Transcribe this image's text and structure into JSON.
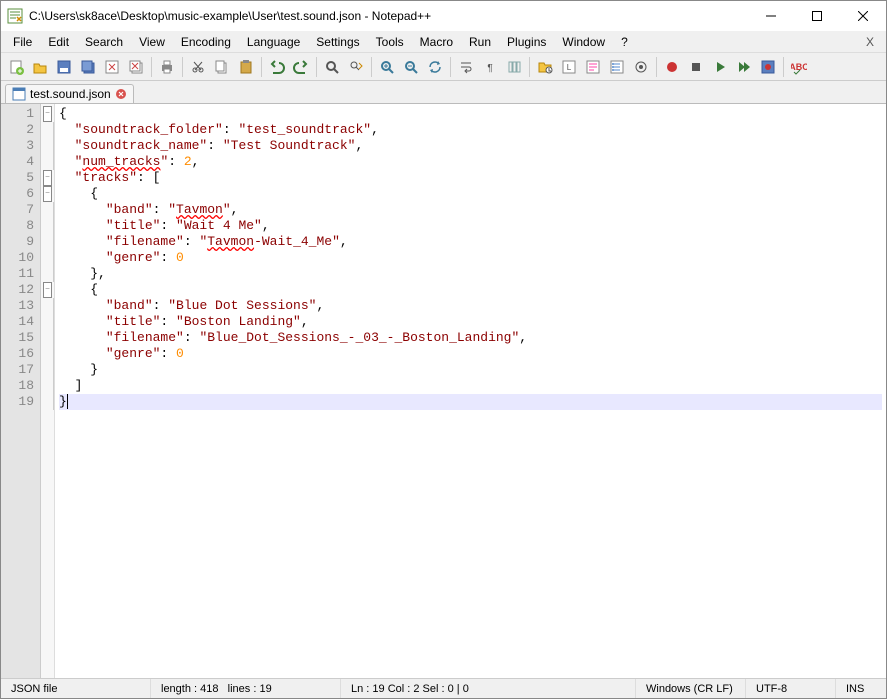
{
  "window": {
    "title": "C:\\Users\\sk8ace\\Desktop\\music-example\\User\\test.sound.json - Notepad++"
  },
  "menu": {
    "items": [
      "File",
      "Edit",
      "Search",
      "View",
      "Encoding",
      "Language",
      "Settings",
      "Tools",
      "Macro",
      "Run",
      "Plugins",
      "Window",
      "?"
    ],
    "closeX": "X"
  },
  "toolbar": {
    "icons": [
      "new",
      "open",
      "save",
      "save-all",
      "close",
      "close-all",
      "print",
      "cut",
      "copy",
      "paste",
      "undo",
      "redo",
      "find",
      "replace",
      "zoom-in",
      "zoom-out",
      "sync",
      "wrap",
      "show-all",
      "indent-guide",
      "folder",
      "ud-lang",
      "doc-map",
      "func-list",
      "monitor",
      "record",
      "stop",
      "play",
      "play-multi",
      "save-macro",
      "spellcheck"
    ]
  },
  "tab": {
    "label": "test.sound.json"
  },
  "code": {
    "lines": [
      {
        "num": 1,
        "fold": "box",
        "tokens": [
          {
            "t": "{",
            "c": "p"
          }
        ]
      },
      {
        "num": 2,
        "fold": "line",
        "tokens": [
          {
            "t": "  ",
            "c": "p"
          },
          {
            "t": "\"soundtrack_folder\"",
            "c": "k"
          },
          {
            "t": ": ",
            "c": "p"
          },
          {
            "t": "\"test_soundtrack\"",
            "c": "k"
          },
          {
            "t": ",",
            "c": "p"
          }
        ]
      },
      {
        "num": 3,
        "fold": "line",
        "tokens": [
          {
            "t": "  ",
            "c": "p"
          },
          {
            "t": "\"soundtrack_name\"",
            "c": "k"
          },
          {
            "t": ": ",
            "c": "p"
          },
          {
            "t": "\"Test Soundtrack\"",
            "c": "k"
          },
          {
            "t": ",",
            "c": "p"
          }
        ]
      },
      {
        "num": 4,
        "fold": "line",
        "tokens": [
          {
            "t": "  ",
            "c": "p"
          },
          {
            "t": "\"",
            "c": "k"
          },
          {
            "t": "num_tracks",
            "c": "k u"
          },
          {
            "t": "\"",
            "c": "k"
          },
          {
            "t": ": ",
            "c": "p"
          },
          {
            "t": "2",
            "c": "n"
          },
          {
            "t": ",",
            "c": "p"
          }
        ]
      },
      {
        "num": 5,
        "fold": "box",
        "tokens": [
          {
            "t": "  ",
            "c": "p"
          },
          {
            "t": "\"tracks\"",
            "c": "k"
          },
          {
            "t": ": [",
            "c": "p"
          }
        ]
      },
      {
        "num": 6,
        "fold": "box",
        "tokens": [
          {
            "t": "    {",
            "c": "p"
          }
        ]
      },
      {
        "num": 7,
        "fold": "line",
        "tokens": [
          {
            "t": "      ",
            "c": "p"
          },
          {
            "t": "\"band\"",
            "c": "k"
          },
          {
            "t": ": ",
            "c": "p"
          },
          {
            "t": "\"",
            "c": "k"
          },
          {
            "t": "Tavmon",
            "c": "k u"
          },
          {
            "t": "\"",
            "c": "k"
          },
          {
            "t": ",",
            "c": "p"
          }
        ]
      },
      {
        "num": 8,
        "fold": "line",
        "tokens": [
          {
            "t": "      ",
            "c": "p"
          },
          {
            "t": "\"title\"",
            "c": "k"
          },
          {
            "t": ": ",
            "c": "p"
          },
          {
            "t": "\"Wait 4 Me\"",
            "c": "k"
          },
          {
            "t": ",",
            "c": "p"
          }
        ]
      },
      {
        "num": 9,
        "fold": "line",
        "tokens": [
          {
            "t": "      ",
            "c": "p"
          },
          {
            "t": "\"filename\"",
            "c": "k"
          },
          {
            "t": ": ",
            "c": "p"
          },
          {
            "t": "\"",
            "c": "k"
          },
          {
            "t": "Tavmon",
            "c": "k u"
          },
          {
            "t": "-Wait_4_Me\"",
            "c": "k"
          },
          {
            "t": ",",
            "c": "p"
          }
        ]
      },
      {
        "num": 10,
        "fold": "line",
        "tokens": [
          {
            "t": "      ",
            "c": "p"
          },
          {
            "t": "\"genre\"",
            "c": "k"
          },
          {
            "t": ": ",
            "c": "p"
          },
          {
            "t": "0",
            "c": "n"
          }
        ]
      },
      {
        "num": 11,
        "fold": "line",
        "tokens": [
          {
            "t": "    },",
            "c": "p"
          }
        ]
      },
      {
        "num": 12,
        "fold": "box",
        "tokens": [
          {
            "t": "    {",
            "c": "p"
          }
        ]
      },
      {
        "num": 13,
        "fold": "line",
        "tokens": [
          {
            "t": "      ",
            "c": "p"
          },
          {
            "t": "\"band\"",
            "c": "k"
          },
          {
            "t": ": ",
            "c": "p"
          },
          {
            "t": "\"Blue Dot Sessions\"",
            "c": "k"
          },
          {
            "t": ",",
            "c": "p"
          }
        ]
      },
      {
        "num": 14,
        "fold": "line",
        "tokens": [
          {
            "t": "      ",
            "c": "p"
          },
          {
            "t": "\"title\"",
            "c": "k"
          },
          {
            "t": ": ",
            "c": "p"
          },
          {
            "t": "\"Boston Landing\"",
            "c": "k"
          },
          {
            "t": ",",
            "c": "p"
          }
        ]
      },
      {
        "num": 15,
        "fold": "line",
        "tokens": [
          {
            "t": "      ",
            "c": "p"
          },
          {
            "t": "\"filename\"",
            "c": "k"
          },
          {
            "t": ": ",
            "c": "p"
          },
          {
            "t": "\"Blue_Dot_Sessions_-_03_-_Boston_Landing\"",
            "c": "k"
          },
          {
            "t": ",",
            "c": "p"
          }
        ]
      },
      {
        "num": 16,
        "fold": "line",
        "tokens": [
          {
            "t": "      ",
            "c": "p"
          },
          {
            "t": "\"genre\"",
            "c": "k"
          },
          {
            "t": ": ",
            "c": "p"
          },
          {
            "t": "0",
            "c": "n"
          }
        ]
      },
      {
        "num": 17,
        "fold": "line",
        "tokens": [
          {
            "t": "    }",
            "c": "p"
          }
        ]
      },
      {
        "num": 18,
        "fold": "line",
        "tokens": [
          {
            "t": "  ]",
            "c": "p"
          }
        ]
      },
      {
        "num": 19,
        "fold": "end",
        "current": true,
        "caret": true,
        "tokens": [
          {
            "t": "}",
            "c": "p"
          }
        ]
      }
    ]
  },
  "status": {
    "filetype": "JSON file",
    "length_label": "length : 418",
    "lines_label": "lines : 19",
    "pos": "Ln : 19   Col : 2   Sel : 0 | 0",
    "eol": "Windows (CR LF)",
    "encoding": "UTF-8",
    "mode": "INS"
  }
}
